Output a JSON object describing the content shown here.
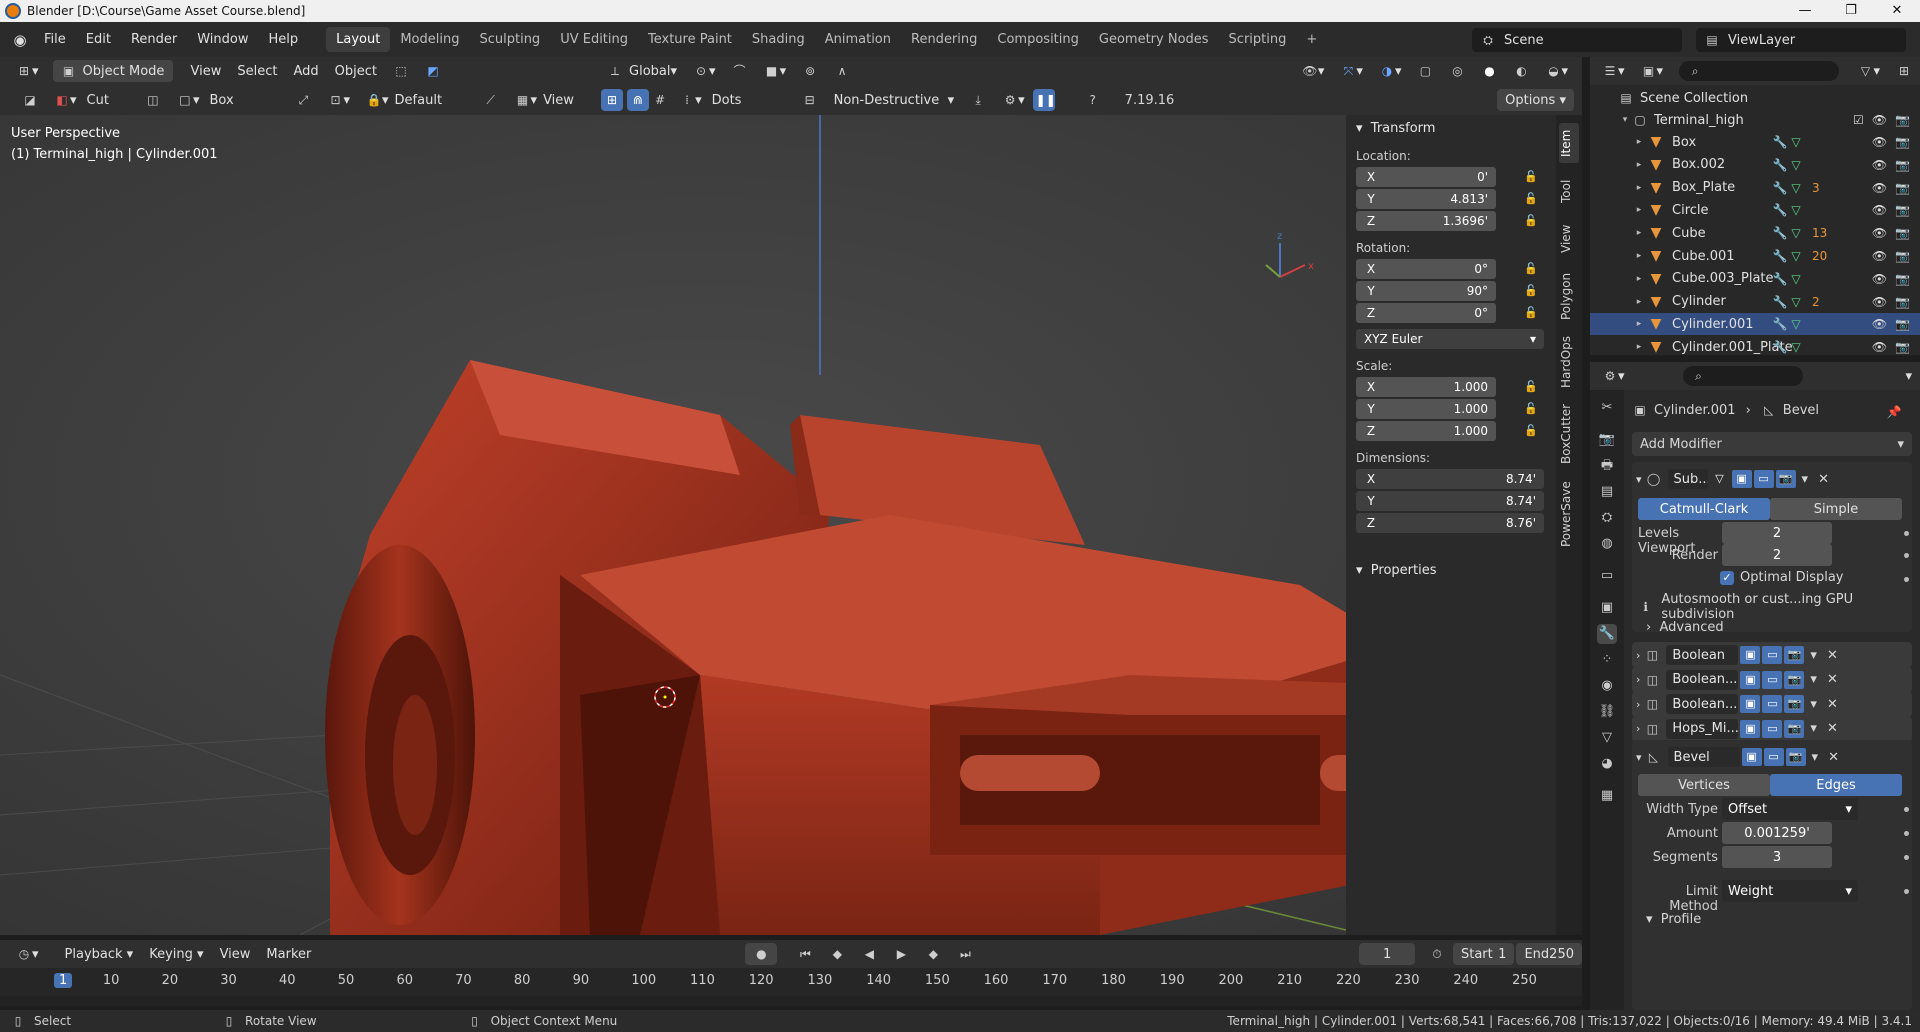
{
  "window": {
    "title": "Blender [D:\\Course\\Game Asset Course.blend]",
    "controls": [
      "—",
      "❐",
      "✕"
    ]
  },
  "menu": [
    "File",
    "Edit",
    "Render",
    "Window",
    "Help"
  ],
  "workspaces": [
    "Layout",
    "Modeling",
    "Sculpting",
    "UV Editing",
    "Texture Paint",
    "Shading",
    "Animation",
    "Rendering",
    "Compositing",
    "Geometry Nodes",
    "Scripting",
    "+"
  ],
  "scene": {
    "label": "Scene",
    "view_layer": "ViewLayer"
  },
  "viewport_header": {
    "mode": "Object Mode",
    "menus": [
      "View",
      "Select",
      "Add",
      "Object"
    ],
    "orientation": "Global"
  },
  "tool_header": {
    "cut": "Cut",
    "shape": "Box",
    "default": "Default",
    "view": "View",
    "dots": "Dots",
    "mode": "Non-Destructive",
    "version": "7.19.16",
    "options": "Options"
  },
  "viewport": {
    "perspective": "User Perspective",
    "object": "(1) Terminal_high | Cylinder.001"
  },
  "npanel": {
    "transform_title": "Transform",
    "location_label": "Location:",
    "location": [
      {
        "axis": "X",
        "value": "0'"
      },
      {
        "axis": "Y",
        "value": "4.813'"
      },
      {
        "axis": "Z",
        "value": "1.3696'"
      }
    ],
    "rotation_label": "Rotation:",
    "rotation": [
      {
        "axis": "X",
        "value": "0°"
      },
      {
        "axis": "Y",
        "value": "90°"
      },
      {
        "axis": "Z",
        "value": "0°"
      }
    ],
    "rotation_mode": "XYZ Euler",
    "scale_label": "Scale:",
    "scale": [
      {
        "axis": "X",
        "value": "1.000"
      },
      {
        "axis": "Y",
        "value": "1.000"
      },
      {
        "axis": "Z",
        "value": "1.000"
      }
    ],
    "dimensions_label": "Dimensions:",
    "dimensions": [
      {
        "axis": "X",
        "value": "8.74'"
      },
      {
        "axis": "Y",
        "value": "8.74'"
      },
      {
        "axis": "Z",
        "value": "8.76'"
      }
    ],
    "properties_title": "Properties",
    "tabs": [
      "Item",
      "Tool",
      "View",
      "Polygon",
      "HardOps",
      "BoxCutter",
      "PowerSave"
    ]
  },
  "outliner": {
    "collection": "Scene Collection",
    "root": "Terminal_high",
    "items": [
      {
        "name": "Box",
        "extra": ""
      },
      {
        "name": "Box.002",
        "extra": ""
      },
      {
        "name": "Box_Plate",
        "extra": "3"
      },
      {
        "name": "Circle",
        "extra": ""
      },
      {
        "name": "Cube",
        "extra": "13"
      },
      {
        "name": "Cube.001",
        "extra": "20"
      },
      {
        "name": "Cube.003_Plate",
        "extra": ""
      },
      {
        "name": "Cylinder",
        "extra": "2"
      },
      {
        "name": "Cylinder.001",
        "extra": ""
      },
      {
        "name": "Cylinder.001_Plate",
        "extra": ""
      }
    ]
  },
  "properties": {
    "breadcrumb_object": "Cylinder.001",
    "breadcrumb_modifier": "Bevel",
    "add_modifier": "Add Modifier",
    "subsurf": {
      "name": "Sub...",
      "catmull": "Catmull-Clark",
      "simple": "Simple",
      "levels_viewport_label": "Levels Viewport",
      "levels_viewport": "2",
      "render_label": "Render",
      "render": "2",
      "optimal_display": "Optimal Display",
      "info": "Autosmooth or cust...ing GPU subdivision",
      "advanced": "Advanced"
    },
    "modifiers": [
      "Boolean",
      "Boolean....",
      "Boolean....",
      "Hops_Mi..."
    ],
    "bevel": {
      "name": "Bevel",
      "vertices": "Vertices",
      "edges": "Edges",
      "width_type_label": "Width Type",
      "width_type": "Offset",
      "amount_label": "Amount",
      "amount": "0.001259'",
      "segments_label": "Segments",
      "segments": "3",
      "limit_label": "Limit Method",
      "limit": "Weight",
      "profile": "Profile"
    }
  },
  "timeline": {
    "menus": [
      "Playback",
      "Keying",
      "View",
      "Marker"
    ],
    "frame": "1",
    "start_label": "Start",
    "start": "1",
    "end_label": "End",
    "end": "250",
    "ticks": [
      "1",
      "10",
      "20",
      "30",
      "40",
      "50",
      "60",
      "70",
      "80",
      "90",
      "100",
      "110",
      "120",
      "130",
      "140",
      "150",
      "160",
      "170",
      "180",
      "190",
      "200",
      "210",
      "220",
      "230",
      "240",
      "250"
    ]
  },
  "status": {
    "select": "Select",
    "rotate": "Rotate View",
    "context": "Object Context Menu",
    "stats": "Terminal_high | Cylinder.001 | Verts:68,541 | Faces:66,708 | Tris:137,022 | Objects:0/16 | Memory: 49.4 MiB | 3.4.1"
  },
  "colors": {
    "accent": "#4772b3",
    "object": "#e8963c",
    "model": "#a8301c"
  }
}
